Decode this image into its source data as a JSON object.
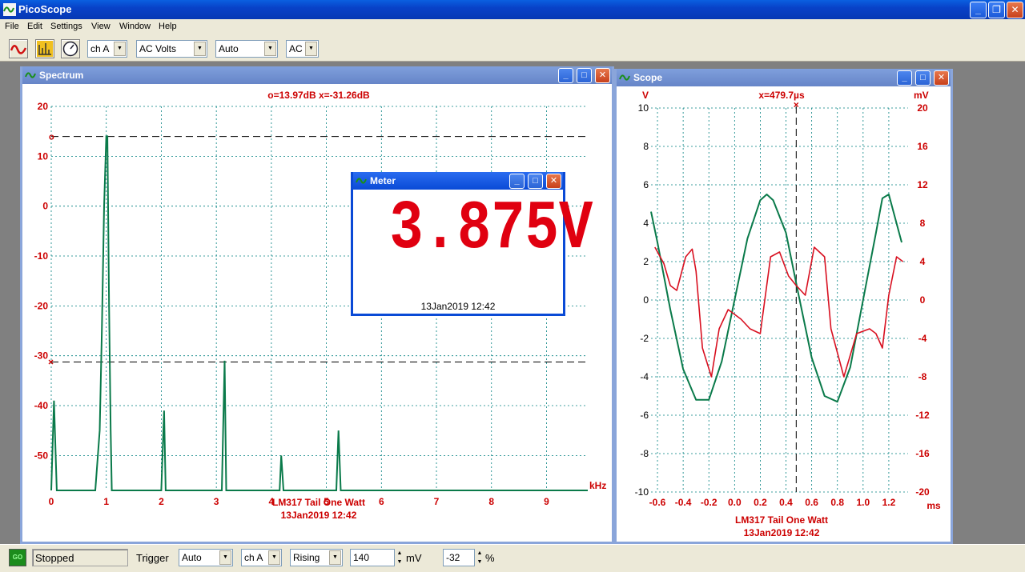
{
  "app": {
    "title": "PicoScope"
  },
  "menu": [
    "File",
    "Edit",
    "Settings",
    "View",
    "Window",
    "Help"
  ],
  "toolbar": {
    "channel": "ch A",
    "mode": "AC Volts",
    "range": "Auto",
    "coupling": "AC"
  },
  "spectrum": {
    "title": "Spectrum",
    "readout": "o=13.97dB  x=-31.26dB",
    "y_ticks": [
      "20",
      "10",
      "0",
      "-10",
      "-20",
      "-30",
      "-40",
      "-50"
    ],
    "x_ticks": [
      "0",
      "1",
      "2",
      "3",
      "4",
      "5",
      "6",
      "7",
      "8",
      "9"
    ],
    "x_unit": "kHz",
    "caption": "LM317 Tail One Watt",
    "date": "13Jan2019  12:42",
    "marker_o_label": "o",
    "marker_x_label": "×"
  },
  "meter": {
    "title": "Meter",
    "value": "3.875V",
    "date": "13Jan2019  12:42"
  },
  "scope": {
    "title": "Scope",
    "readout": "x=479.7µs",
    "left_unit": "V",
    "right_unit": "mV",
    "x_unit": "ms",
    "left_ticks": [
      "10",
      "8",
      "6",
      "4",
      "2",
      "0",
      "-2",
      "-4",
      "-6",
      "-8",
      "-10"
    ],
    "right_ticks": [
      "20",
      "16",
      "12",
      "8",
      "4",
      "0",
      "-4",
      "-8",
      "-12",
      "-16",
      "-20"
    ],
    "x_ticks": [
      "-0.6",
      "-0.4",
      "-0.2",
      "0.0",
      "0.2",
      "0.4",
      "0.6",
      "0.8",
      "1.0",
      "1.2"
    ],
    "caption": "LM317 Tail One Watt",
    "date": "13Jan2019  12:42",
    "marker_label": "×"
  },
  "status": {
    "state": "Stopped",
    "led": "GO",
    "trigger_label": "Trigger",
    "trigger_mode": "Auto",
    "trigger_channel": "ch A",
    "trigger_edge": "Rising",
    "trigger_level": "140",
    "level_unit": "mV",
    "pretrigger": "-32",
    "pretrigger_unit": "%"
  },
  "colors": {
    "trace_green": "#0a7a4a",
    "trace_red": "#d81020",
    "label_red": "#cc0000",
    "grid": "#008080"
  },
  "chart_data": [
    {
      "type": "line",
      "name": "Spectrum",
      "xlabel": "kHz",
      "ylabel": "",
      "xlim": [
        0,
        9.75
      ],
      "ylim": [
        -57,
        20
      ],
      "x": [
        0.0,
        0.05,
        0.1,
        0.14,
        0.8,
        0.88,
        0.92,
        0.96,
        1.0,
        1.02,
        1.05,
        1.08,
        1.1,
        1.15,
        1.2,
        2.0,
        2.05,
        2.08,
        3.1,
        3.15,
        3.18,
        4.15,
        4.18,
        4.22,
        5.18,
        5.22,
        5.26,
        9.75
      ],
      "y": [
        -57,
        -39,
        -57,
        -57,
        -57,
        -45,
        -25,
        0,
        14,
        14,
        -20,
        -45,
        -57,
        -57,
        -57,
        -57,
        -41,
        -57,
        -57,
        -31,
        -57,
        -57,
        -50,
        -57,
        -57,
        -45,
        -57,
        -57
      ],
      "markers": {
        "o": 13.97,
        "x": -31.26
      }
    },
    {
      "type": "line",
      "name": "Scope",
      "xlabel": "ms",
      "ylabel_left": "V",
      "ylabel_right": "mV",
      "xlim": [
        -0.65,
        1.35
      ],
      "ylim_left": [
        -10,
        10
      ],
      "ylim_right": [
        -20,
        20
      ],
      "series": [
        {
          "axis": "left",
          "x": [
            -0.65,
            -0.6,
            -0.5,
            -0.4,
            -0.3,
            -0.2,
            -0.1,
            0.0,
            0.1,
            0.2,
            0.25,
            0.3,
            0.4,
            0.5,
            0.6,
            0.7,
            0.8,
            0.9,
            1.0,
            1.1,
            1.15,
            1.2,
            1.3
          ],
          "y": [
            4.6,
            3.0,
            -0.5,
            -3.6,
            -5.2,
            -5.2,
            -3.2,
            0.0,
            3.2,
            5.2,
            5.5,
            5.2,
            3.5,
            0.2,
            -3.0,
            -5.0,
            -5.3,
            -3.5,
            0.0,
            3.5,
            5.3,
            5.5,
            3.0
          ]
        },
        {
          "axis": "right",
          "x": [
            -0.62,
            -0.55,
            -0.5,
            -0.45,
            -0.38,
            -0.33,
            -0.3,
            -0.25,
            -0.18,
            -0.12,
            -0.05,
            0.05,
            0.12,
            0.2,
            0.28,
            0.35,
            0.42,
            0.48,
            0.55,
            0.62,
            0.7,
            0.75,
            0.85,
            0.95,
            1.05,
            1.1,
            1.15,
            1.2,
            1.26,
            1.31
          ],
          "y": [
            5.5,
            3.8,
            1.5,
            1.0,
            4.5,
            5.3,
            3.0,
            -5.0,
            -8.0,
            -3.0,
            -1.0,
            -2.0,
            -3.0,
            -3.5,
            4.5,
            5.0,
            2.5,
            1.5,
            0.5,
            5.5,
            4.5,
            -3.0,
            -8.0,
            -3.5,
            -3.0,
            -3.5,
            -5.0,
            0.5,
            4.5,
            4.0
          ]
        }
      ],
      "marker_x_ms": 0.4797
    }
  ]
}
